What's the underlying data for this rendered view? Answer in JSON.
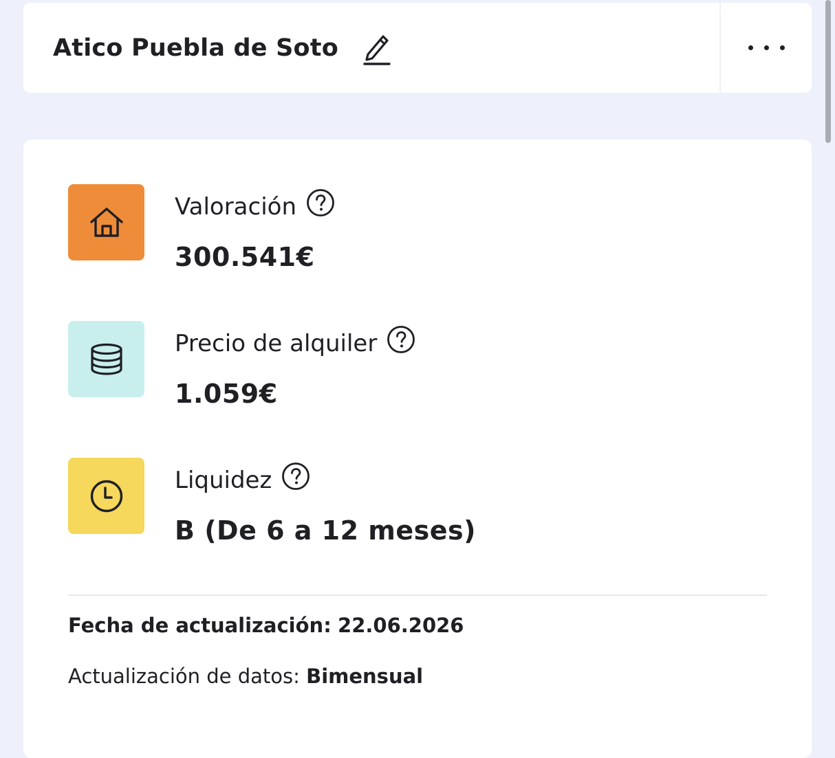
{
  "header": {
    "title": "Atico Puebla de Soto",
    "edit_icon": "pencil-icon",
    "more_icon": "more-horizontal-icon"
  },
  "metrics": [
    {
      "label": "Valoración",
      "value": "300.541€",
      "icon": "house-icon",
      "color": "#ee8c3a"
    },
    {
      "label": "Precio de alquiler",
      "value": "1.059€",
      "icon": "coin-stack-icon",
      "color": "#c8efee"
    },
    {
      "label": "Liquidez",
      "value": "B (De 6 a 12 meses)",
      "icon": "clock-icon",
      "color": "#f5d85c"
    }
  ],
  "footer": {
    "update_date_label": "Fecha de actualización:",
    "update_date_value": "22.06.2026",
    "update_freq_label": "Actualización de datos:",
    "update_freq_value": "Bimensual"
  }
}
